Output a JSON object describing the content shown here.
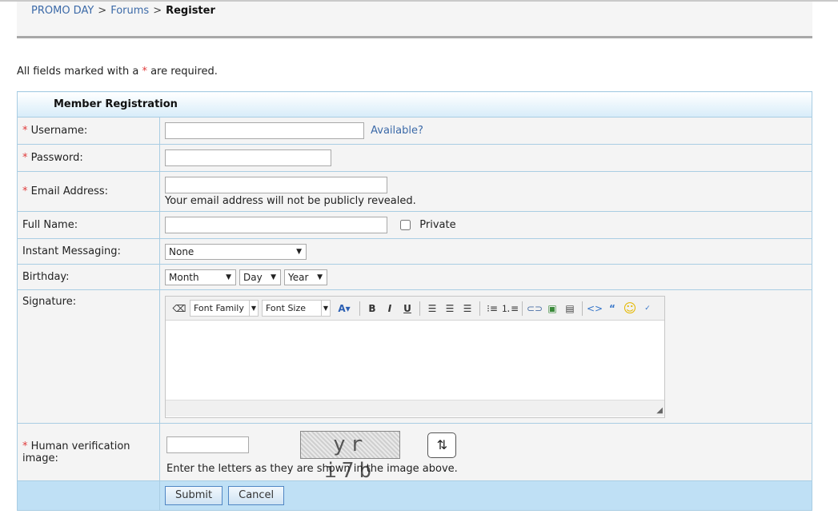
{
  "breadcrumb": {
    "items": [
      "PROMO DAY",
      "Forums"
    ],
    "separator": ">",
    "current": "Register"
  },
  "required_note": {
    "before": "All fields marked with a",
    "star": "*",
    "after": "are required."
  },
  "form": {
    "title": "Member Registration",
    "username_label": "Username:",
    "username_value": "",
    "available_link": "Available?",
    "password_label": "Password:",
    "password_value": "",
    "email_label": "Email Address:",
    "email_value": "",
    "email_hint": "Your email address will not be publicly revealed.",
    "fullname_label": "Full Name:",
    "fullname_value": "",
    "private_label": "Private",
    "private_checked": false,
    "im_label": "Instant Messaging:",
    "im_selected": "None",
    "birthday_label": "Birthday:",
    "birthday_month": "Month",
    "birthday_day": "Day",
    "birthday_year": "Year",
    "signature_label": "Signature:",
    "editor": {
      "font_family": "Font Family",
      "font_size": "Font Size",
      "bold": "B",
      "italic": "I",
      "underline": "U"
    },
    "captcha_label": "Human verification image:",
    "captcha_value": "",
    "captcha_text": "yr i7b",
    "captcha_hint": "Enter the letters as they are shown in the image above.",
    "submit": "Submit",
    "cancel": "Cancel"
  },
  "colors": {
    "link": "#3c6aa8",
    "required_star": "#e03a3a",
    "table_border": "#a9cde3",
    "button_row": "#bfe0f5"
  }
}
